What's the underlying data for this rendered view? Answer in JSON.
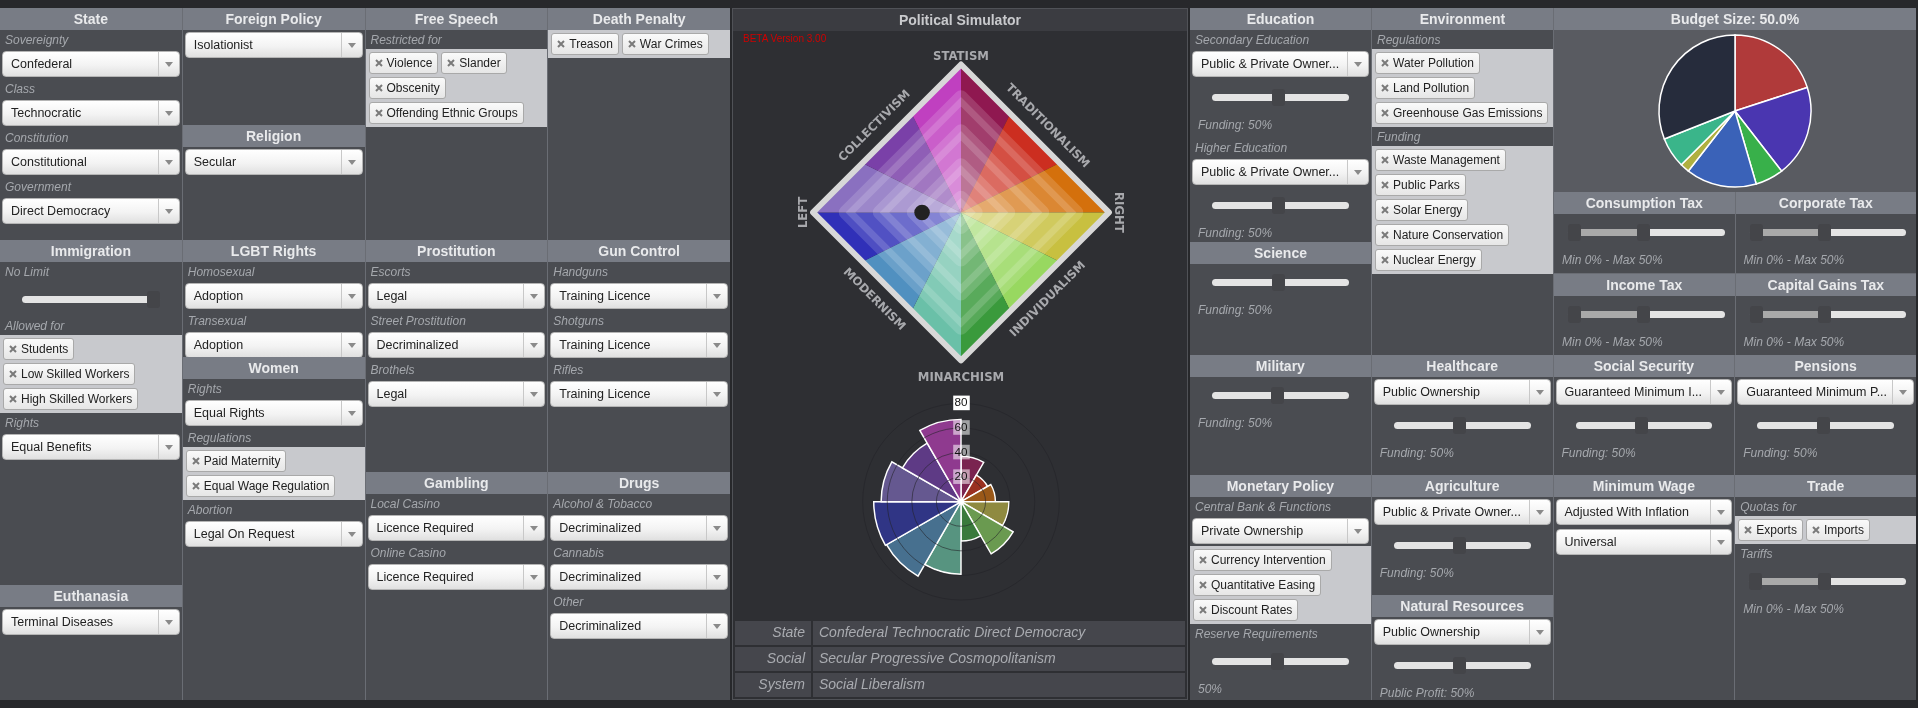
{
  "left": {
    "rows": [
      {
        "columns": [
          {
            "kind": "stack",
            "sections": [
              {
                "title": "State",
                "items": [
                  {
                    "kind": "label",
                    "text": "Sovereignty"
                  },
                  {
                    "kind": "select",
                    "value": "Confederal"
                  },
                  {
                    "kind": "label",
                    "text": "Class"
                  },
                  {
                    "kind": "select",
                    "value": "Technocratic"
                  },
                  {
                    "kind": "label",
                    "text": "Constitution"
                  },
                  {
                    "kind": "select",
                    "value": "Constitutional"
                  },
                  {
                    "kind": "label",
                    "text": "Government"
                  },
                  {
                    "kind": "select",
                    "value": "Direct Democracy"
                  }
                ]
              }
            ]
          },
          {
            "kind": "stack",
            "sections": [
              {
                "title": "Foreign Policy",
                "items": [
                  {
                    "kind": "select",
                    "value": "Isolationist"
                  }
                ]
              },
              {
                "title": "Religion",
                "items": [
                  {
                    "kind": "select",
                    "value": "Secular"
                  }
                ]
              }
            ]
          },
          {
            "kind": "stack",
            "sections": [
              {
                "title": "Free Speech",
                "items": [
                  {
                    "kind": "label",
                    "text": "Restricted for"
                  },
                  {
                    "kind": "tags",
                    "tags": [
                      "Violence",
                      "Slander",
                      "Obscenity",
                      "Offending Ethnic Groups"
                    ]
                  }
                ]
              }
            ]
          },
          {
            "kind": "stack",
            "sections": [
              {
                "title": "Death Penalty",
                "items": [
                  {
                    "kind": "tags",
                    "tags": [
                      "Treason",
                      "War Crimes"
                    ]
                  }
                ]
              }
            ]
          }
        ]
      },
      {
        "columns": [
          {
            "kind": "stack",
            "sections": [
              {
                "title": "Immigration",
                "items": [
                  {
                    "kind": "label",
                    "text": "No Limit"
                  },
                  {
                    "kind": "slider",
                    "level": 1
                  },
                  {
                    "kind": "label",
                    "text": "Allowed for"
                  },
                  {
                    "kind": "tags",
                    "tags": [
                      "Students",
                      "Low Skilled Workers",
                      "High Skilled Workers"
                    ]
                  },
                  {
                    "kind": "label",
                    "text": "Rights"
                  },
                  {
                    "kind": "select",
                    "value": "Equal Benefits"
                  }
                ]
              },
              {
                "title": "Euthanasia",
                "items": [
                  {
                    "kind": "select",
                    "value": "Terminal Diseases"
                  }
                ]
              }
            ]
          },
          {
            "kind": "stack",
            "sections": [
              {
                "title": "LGBT Rights",
                "items": [
                  {
                    "kind": "label",
                    "text": "Homosexual"
                  },
                  {
                    "kind": "select",
                    "value": "Adoption"
                  },
                  {
                    "kind": "label",
                    "text": "Transexual"
                  },
                  {
                    "kind": "select",
                    "value": "Adoption"
                  }
                ]
              },
              {
                "title": "Women",
                "items": [
                  {
                    "kind": "label",
                    "text": "Rights"
                  },
                  {
                    "kind": "select",
                    "value": "Equal Rights"
                  },
                  {
                    "kind": "label",
                    "text": "Regulations"
                  },
                  {
                    "kind": "tags",
                    "tags": [
                      "Paid Maternity",
                      "Equal Wage Regulation"
                    ]
                  },
                  {
                    "kind": "label",
                    "text": "Abortion"
                  },
                  {
                    "kind": "select",
                    "value": "Legal On Request"
                  }
                ]
              }
            ]
          },
          {
            "kind": "stack",
            "sections": [
              {
                "title": "Prostitution",
                "items": [
                  {
                    "kind": "label",
                    "text": "Escorts"
                  },
                  {
                    "kind": "select",
                    "value": "Legal"
                  },
                  {
                    "kind": "label",
                    "text": "Street Prostitution"
                  },
                  {
                    "kind": "select",
                    "value": "Decriminalized"
                  },
                  {
                    "kind": "label",
                    "text": "Brothels"
                  },
                  {
                    "kind": "select",
                    "value": "Legal"
                  }
                ]
              },
              {
                "title": "Gambling",
                "items": [
                  {
                    "kind": "label",
                    "text": "Local Casino"
                  },
                  {
                    "kind": "select",
                    "value": "Licence Required"
                  },
                  {
                    "kind": "label",
                    "text": "Online Casino"
                  },
                  {
                    "kind": "select",
                    "value": "Licence Required"
                  }
                ]
              }
            ]
          },
          {
            "kind": "stack",
            "sections": [
              {
                "title": "Gun Control",
                "items": [
                  {
                    "kind": "label",
                    "text": "Handguns"
                  },
                  {
                    "kind": "select",
                    "value": "Training Licence"
                  },
                  {
                    "kind": "label",
                    "text": "Shotguns"
                  },
                  {
                    "kind": "select",
                    "value": "Training Licence"
                  },
                  {
                    "kind": "label",
                    "text": "Rifles"
                  },
                  {
                    "kind": "select",
                    "value": "Training Licence"
                  }
                ]
              },
              {
                "title": "Drugs",
                "items": [
                  {
                    "kind": "label",
                    "text": "Alcohol & Tobacco"
                  },
                  {
                    "kind": "select",
                    "value": "Decriminalized"
                  },
                  {
                    "kind": "label",
                    "text": "Cannabis"
                  },
                  {
                    "kind": "select",
                    "value": "Decriminalized"
                  },
                  {
                    "kind": "label",
                    "text": "Other"
                  },
                  {
                    "kind": "select",
                    "value": "Decriminalized"
                  }
                ]
              }
            ]
          }
        ]
      }
    ]
  },
  "center": {
    "title": "Political Simulator",
    "version": "BETA Version 3.00",
    "compass_labels": [
      "STATISM",
      "TRADITIONALISM",
      "RIGHT",
      "INDIVIDUALISM",
      "MINARCHISM",
      "MODERNISM",
      "LEFT",
      "COLLECTIVISM"
    ],
    "polar_chart": {
      "ticks": [
        "80",
        "60",
        "40",
        "20"
      ]
    },
    "summary": [
      {
        "label": "State",
        "value": "Confederal Technocratic Direct Democracy"
      },
      {
        "label": "Social",
        "value": "Secular Progressive Cosmopolitanism"
      },
      {
        "label": "System",
        "value": "Social Liberalism"
      }
    ]
  },
  "right": {
    "rows": [
      {
        "columns": [
          {
            "kind": "stack",
            "sections": [
              {
                "title": "Education",
                "items": [
                  {
                    "kind": "label",
                    "text": "Secondary Education"
                  },
                  {
                    "kind": "select",
                    "value": "Public & Private Owner..."
                  },
                  {
                    "kind": "slider",
                    "level": 0.48
                  },
                  {
                    "kind": "note",
                    "text": "Funding: 50%"
                  },
                  {
                    "kind": "label",
                    "text": "Higher Education"
                  },
                  {
                    "kind": "select",
                    "value": "Public & Private Owner..."
                  },
                  {
                    "kind": "slider",
                    "level": 0.48
                  },
                  {
                    "kind": "note",
                    "text": "Funding: 50%"
                  }
                ]
              },
              {
                "title": "Science",
                "items": [
                  {
                    "kind": "slider",
                    "level": 0.48
                  },
                  {
                    "kind": "note",
                    "text": "Funding: 50%"
                  }
                ]
              }
            ]
          },
          {
            "kind": "stack",
            "sections": [
              {
                "title": "Environment",
                "items": [
                  {
                    "kind": "label",
                    "text": "Regulations"
                  },
                  {
                    "kind": "tags",
                    "tags": [
                      "Water Pollution",
                      "Land Pollution",
                      "Greenhouse Gas Emissions"
                    ]
                  },
                  {
                    "kind": "label",
                    "text": "Funding"
                  },
                  {
                    "kind": "tags",
                    "tags": [
                      "Waste Management",
                      "Public Parks",
                      "Solar Energy",
                      "Nature Conservation",
                      "Nuclear Energy"
                    ]
                  }
                ]
              }
            ]
          },
          {
            "kind": "budget",
            "title": "Budget Size: 50.0%",
            "taxes": [
              {
                "title": "Consumption Tax",
                "items": [
                  {
                    "kind": "range",
                    "level": 0.48
                  },
                  {
                    "kind": "note",
                    "text": "Min 0% - Max 50%"
                  }
                ]
              },
              {
                "title": "Corporate Tax",
                "items": [
                  {
                    "kind": "range",
                    "level": 0.48
                  },
                  {
                    "kind": "note",
                    "text": "Min 0% - Max 50%"
                  }
                ]
              },
              {
                "title": "Income Tax",
                "items": [
                  {
                    "kind": "range",
                    "level": 0.48
                  },
                  {
                    "kind": "note",
                    "text": "Min 0% - Max 50%"
                  }
                ]
              },
              {
                "title": "Capital Gains Tax",
                "items": [
                  {
                    "kind": "range",
                    "level": 0.48
                  },
                  {
                    "kind": "note",
                    "text": "Min 0% - Max 50%"
                  }
                ]
              }
            ]
          }
        ]
      },
      {
        "columns": [
          {
            "kind": "stack",
            "sections": [
              {
                "title": "Military",
                "items": [
                  {
                    "kind": "slider",
                    "level": 0.48
                  },
                  {
                    "kind": "note",
                    "text": "Funding: 50%"
                  }
                ]
              }
            ]
          },
          {
            "kind": "stack",
            "sections": [
              {
                "title": "Healthcare",
                "items": [
                  {
                    "kind": "select",
                    "value": "Public Ownership"
                  },
                  {
                    "kind": "slider",
                    "level": 0.48
                  },
                  {
                    "kind": "note",
                    "text": "Funding: 50%"
                  }
                ]
              }
            ]
          },
          {
            "kind": "stack",
            "sections": [
              {
                "title": "Social Security",
                "items": [
                  {
                    "kind": "select",
                    "value": "Guaranteed Minimum I..."
                  },
                  {
                    "kind": "slider",
                    "level": 0.48
                  },
                  {
                    "kind": "note",
                    "text": "Funding: 50%"
                  }
                ]
              }
            ]
          },
          {
            "kind": "stack",
            "sections": [
              {
                "title": "Pensions",
                "items": [
                  {
                    "kind": "select",
                    "value": "Guaranteed Minimum P..."
                  },
                  {
                    "kind": "slider",
                    "level": 0.48
                  },
                  {
                    "kind": "note",
                    "text": "Funding: 50%"
                  }
                ]
              }
            ]
          }
        ]
      },
      {
        "columns": [
          {
            "kind": "stack",
            "sections": [
              {
                "title": "Monetary Policy",
                "items": [
                  {
                    "kind": "label",
                    "text": "Central Bank & Functions"
                  },
                  {
                    "kind": "select",
                    "value": "Private Ownership"
                  },
                  {
                    "kind": "tags",
                    "tags": [
                      "Currency Intervention",
                      "Quantitative Easing",
                      "Discount Rates"
                    ]
                  },
                  {
                    "kind": "label",
                    "text": "Reserve Requirements"
                  },
                  {
                    "kind": "slider",
                    "level": 0.48
                  },
                  {
                    "kind": "note",
                    "text": "50%"
                  }
                ]
              }
            ]
          },
          {
            "kind": "stack",
            "sections": [
              {
                "title": "Agriculture",
                "items": [
                  {
                    "kind": "select",
                    "value": "Public & Private Owner..."
                  },
                  {
                    "kind": "slider",
                    "level": 0.48
                  },
                  {
                    "kind": "note",
                    "text": "Funding: 50%"
                  }
                ]
              },
              {
                "title": "Natural Resources",
                "items": [
                  {
                    "kind": "select",
                    "value": "Public Ownership"
                  },
                  {
                    "kind": "slider",
                    "level": 0.48
                  },
                  {
                    "kind": "note",
                    "text": "Public Profit: 50%"
                  }
                ]
              }
            ]
          },
          {
            "kind": "stack",
            "sections": [
              {
                "title": "Minimum Wage",
                "items": [
                  {
                    "kind": "select",
                    "value": "Adjusted With Inflation"
                  },
                  {
                    "kind": "select",
                    "value": "Universal"
                  }
                ]
              }
            ]
          },
          {
            "kind": "stack",
            "sections": [
              {
                "title": "Trade",
                "items": [
                  {
                    "kind": "label",
                    "text": "Quotas for"
                  },
                  {
                    "kind": "tags",
                    "tags": [
                      "Exports",
                      "Imports"
                    ]
                  },
                  {
                    "kind": "label",
                    "text": "Tariffs"
                  },
                  {
                    "kind": "range",
                    "level": 0.48
                  },
                  {
                    "kind": "note",
                    "text": "Min 0% - Max 50%"
                  }
                ]
              }
            ]
          }
        ]
      }
    ]
  }
}
